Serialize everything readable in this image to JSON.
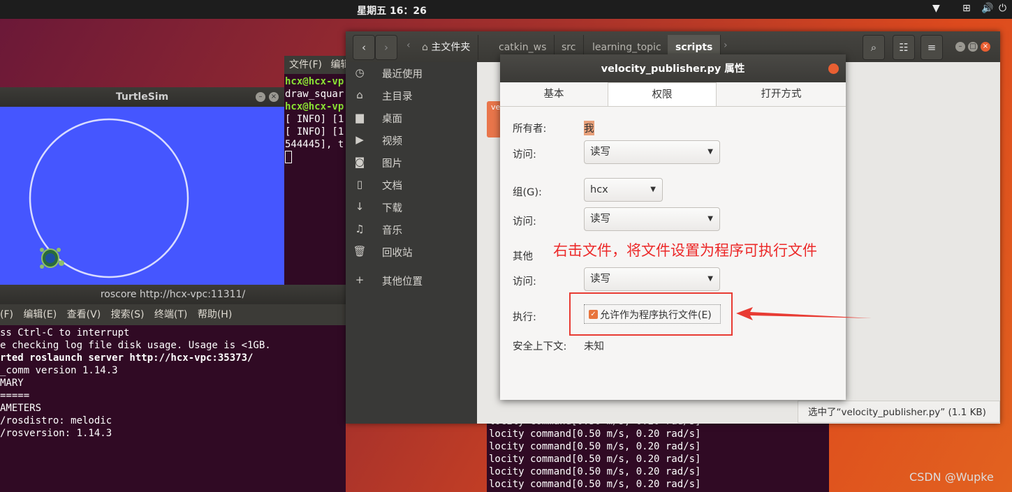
{
  "topbar": {
    "clock": "星期五 16：26"
  },
  "turtlesim": {
    "title": "TurtleSim"
  },
  "terminal_upper": {
    "menu_file": "文件(F)",
    "menu_edit": "编辑",
    "lines": [
      "hcx@hcx-vp",
      "draw_squar",
      "hcx@hcx-vp",
      "[ INFO] [1",
      "[ INFO] [1",
      "544445], t"
    ]
  },
  "roscore": {
    "title": "roscore http://hcx-vpc:11311/",
    "menu": [
      "(F)",
      "编辑(E)",
      "查看(V)",
      "搜索(S)",
      "终端(T)",
      "帮助(H)"
    ],
    "lines": [
      "ss Ctrl-C to interrupt",
      "e checking log file disk usage. Usage is <1GB.",
      "",
      "rted roslaunch server http://hcx-vpc:35373/",
      "_comm version 1.14.3",
      "",
      "",
      "MARY",
      "=====",
      "",
      "AMETERS",
      "/rosdistro: melodic",
      "/rosversion: 1.14.3"
    ]
  },
  "terminal_lower": {
    "lines": [
      "locity command[0.50 m/s, 0.20 rad/s]",
      "locity command[0.50 m/s, 0.20 rad/s]",
      "locity command[0.50 m/s, 0.20 rad/s]",
      "locity command[0.50 m/s, 0.20 rad/s]",
      "locity command[0.50 m/s, 0.20 rad/s]",
      "locity command[0.50 m/s, 0.20 rad/s]"
    ]
  },
  "files": {
    "breadcrumbs": [
      "主文件夹",
      "catkin_ws",
      "src",
      "learning_topic",
      "scripts"
    ],
    "sidebar": [
      {
        "icon": "clock-icon",
        "label": "最近使用"
      },
      {
        "icon": "home-icon",
        "label": "主目录"
      },
      {
        "icon": "folder-icon",
        "label": "桌面"
      },
      {
        "icon": "video-icon",
        "label": "视频"
      },
      {
        "icon": "camera-icon",
        "label": "图片"
      },
      {
        "icon": "document-icon",
        "label": "文档"
      },
      {
        "icon": "download-icon",
        "label": "下载"
      },
      {
        "icon": "music-icon",
        "label": "音乐"
      },
      {
        "icon": "trash-icon",
        "label": "回收站"
      },
      {
        "icon": "plus-icon",
        "label": "其他位置"
      }
    ],
    "file_tile_text": "ve py",
    "status": "选中了“velocity_publisher.py” (1.1 KB)"
  },
  "dialog": {
    "title": "velocity_publisher.py 属性",
    "tabs": [
      "基本",
      "权限",
      "打开方式"
    ],
    "owner_label": "所有者:",
    "owner_value": "我",
    "access_label": "访问:",
    "owner_access": "读写",
    "group_label": "组(G):",
    "group_value": "hcx",
    "group_access": "读写",
    "others_label": "其他",
    "others_access": "读写",
    "exec_label": "执行:",
    "exec_checkbox": "允许作为程序执行文件(E)",
    "context_label": "安全上下文:",
    "context_value": "未知"
  },
  "annotation": {
    "text": "右击文件，将文件设置为程序可执行文件",
    "color": "#ec2929"
  },
  "watermark": "CSDN @Wupke"
}
